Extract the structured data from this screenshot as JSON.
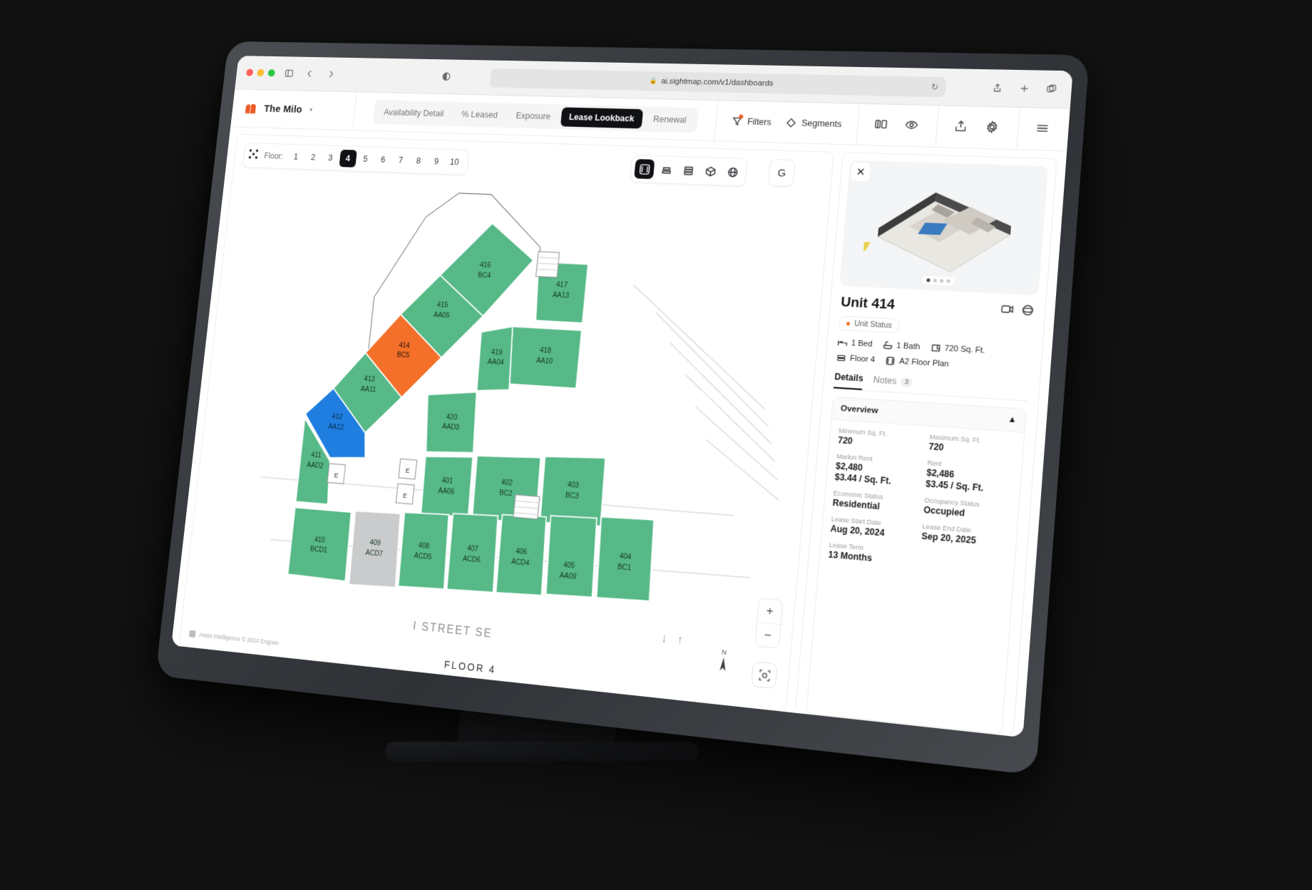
{
  "browser": {
    "url": "ai.sightmap.com/v1/dashboards",
    "lock_icon": "lock-icon",
    "reload_icon": "reload-icon",
    "sidebar_icon": "sidebar-toggle-icon",
    "back_icon": "chevron-left-icon",
    "forward_icon": "chevron-right-icon",
    "shield_icon": "privacy-shield-icon",
    "share_icon": "share-icon",
    "new_tab_icon": "plus-icon",
    "tabs_icon": "tab-overview-icon"
  },
  "header": {
    "property_name": "The Milo",
    "property_caret": "▾",
    "logo_icon": "sightmap-logo-icon",
    "tabs": [
      {
        "label": "Availability Detail",
        "active": false
      },
      {
        "label": "% Leased",
        "active": false
      },
      {
        "label": "Exposure",
        "active": false
      },
      {
        "label": "Lease Lookback",
        "active": true
      },
      {
        "label": "Renewal",
        "active": false
      }
    ],
    "filters_label": "Filters",
    "segments_label": "Segments",
    "icons": [
      "compare-icon",
      "eye-icon",
      "upload-icon",
      "settings-gear-icon",
      "menu-icon"
    ]
  },
  "map": {
    "floor_label": "Floor:",
    "floors": [
      "1",
      "2",
      "3",
      "4",
      "5",
      "6",
      "7",
      "8",
      "9",
      "10"
    ],
    "selected_floor": "4",
    "grid_icon": "expand-grid-icon",
    "view_modes": [
      "floorplan-grid-icon",
      "stack-2d-icon",
      "stack-layers-icon",
      "cube-3d-icon",
      "globe-icon"
    ],
    "selected_view_mode": "floorplan-grid-icon",
    "g_button": "G",
    "street_label": "I STREET SE",
    "floor_caption": "FLOOR 4",
    "attribution": "Asset Intelligence  © 2024 Engrain",
    "compass_label": "N",
    "zoom_in": "+",
    "zoom_out": "−",
    "recenter_icon": "recenter-icon",
    "elevator_label": "E",
    "units": [
      {
        "number": "416",
        "plan": "BC4",
        "status": "green"
      },
      {
        "number": "415",
        "plan": "AA05",
        "status": "green"
      },
      {
        "number": "414",
        "plan": "BC5",
        "status": "orange"
      },
      {
        "number": "413",
        "plan": "AA11",
        "status": "green"
      },
      {
        "number": "412",
        "plan": "AA12",
        "status": "blue"
      },
      {
        "number": "411",
        "plan": "AAD2",
        "status": "green"
      },
      {
        "number": "410",
        "plan": "BCD1",
        "status": "green"
      },
      {
        "number": "409",
        "plan": "ACD7",
        "status": "gray"
      },
      {
        "number": "408",
        "plan": "ACD5",
        "status": "green"
      },
      {
        "number": "407",
        "plan": "ACD6",
        "status": "green"
      },
      {
        "number": "406",
        "plan": "ACD4",
        "status": "green"
      },
      {
        "number": "405",
        "plan": "AA09",
        "status": "green"
      },
      {
        "number": "404",
        "plan": "BC1",
        "status": "green"
      },
      {
        "number": "403",
        "plan": "BC3",
        "status": "green"
      },
      {
        "number": "402",
        "plan": "BC2",
        "status": "green"
      },
      {
        "number": "401",
        "plan": "AA06",
        "status": "green"
      },
      {
        "number": "417",
        "plan": "AA13",
        "status": "green"
      },
      {
        "number": "418",
        "plan": "AA10",
        "status": "green"
      },
      {
        "number": "419",
        "plan": "AA04",
        "status": "green"
      },
      {
        "number": "420",
        "plan": "AAD3",
        "status": "green"
      }
    ],
    "colors": {
      "available": "#56b987",
      "selected": "#f4702a",
      "highlight": "#1f7ee0",
      "unavailable": "#c9cbcc"
    }
  },
  "panel": {
    "close_icon": "close-icon",
    "unit_title": "Unit 414",
    "video_icon": "video-tour-icon",
    "threesixty_icon": "360-view-icon",
    "status_label": "Unit Status",
    "status_color": "#f4702a",
    "meta": [
      {
        "icon": "bed-icon",
        "label": "1 Bed"
      },
      {
        "icon": "bath-icon",
        "label": "1 Bath"
      },
      {
        "icon": "area-icon",
        "label": "720 Sq. Ft."
      },
      {
        "icon": "floor-icon",
        "label": "Floor 4"
      },
      {
        "icon": "plan-icon",
        "label": "A2 Floor Plan"
      }
    ],
    "tabs": [
      {
        "label": "Details",
        "active": true,
        "badge": ""
      },
      {
        "label": "Notes",
        "active": false,
        "badge": "3"
      }
    ],
    "section_title": "Overview",
    "collapse_icon": "chevron-up-icon",
    "fields": [
      {
        "label": "Minimum Sq. Ft.",
        "value": "720"
      },
      {
        "label": "Maximum Sq. Ft.",
        "value": "720"
      },
      {
        "label": "Market Rent",
        "value": "$2,480\n$3.44 / Sq. Ft."
      },
      {
        "label": "Rent",
        "value": "$2,486\n$3.45 / Sq. Ft."
      },
      {
        "label": "Economic Status",
        "value": "Residential"
      },
      {
        "label": "Occupancy Status",
        "value": "Occupied"
      },
      {
        "label": "Lease Start Date",
        "value": "Aug 20, 2024"
      },
      {
        "label": "Lease End Date",
        "value": "Sep 20, 2025"
      },
      {
        "label": "Lease Term",
        "value": "13 Months"
      }
    ]
  }
}
